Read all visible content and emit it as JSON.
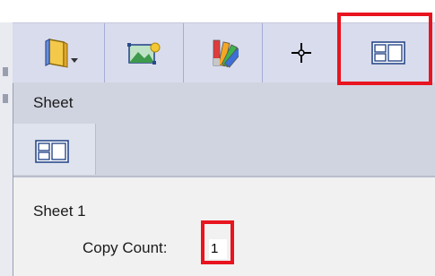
{
  "toolbar": {
    "buttons": [
      {
        "name": "book-dropdown",
        "icon": "book-icon"
      },
      {
        "name": "image-insert",
        "icon": "picture-icon"
      },
      {
        "name": "color-swatches",
        "icon": "color-swatch-icon"
      },
      {
        "name": "crosshair-move",
        "icon": "crosshair-icon"
      },
      {
        "name": "sheet-layout",
        "icon": "sheet-layout-icon",
        "highlighted": true
      }
    ]
  },
  "sheet_panel": {
    "title": "Sheet"
  },
  "body": {
    "sheet_name": "Sheet 1",
    "copy_count_label": "Copy Count:",
    "copy_count_value": "1"
  },
  "colors": {
    "highlight": "#e8141f",
    "toolbar_bg": "#d9dcec",
    "panel_bg": "#d0d4e0",
    "body_bg": "#f1f1f1"
  }
}
